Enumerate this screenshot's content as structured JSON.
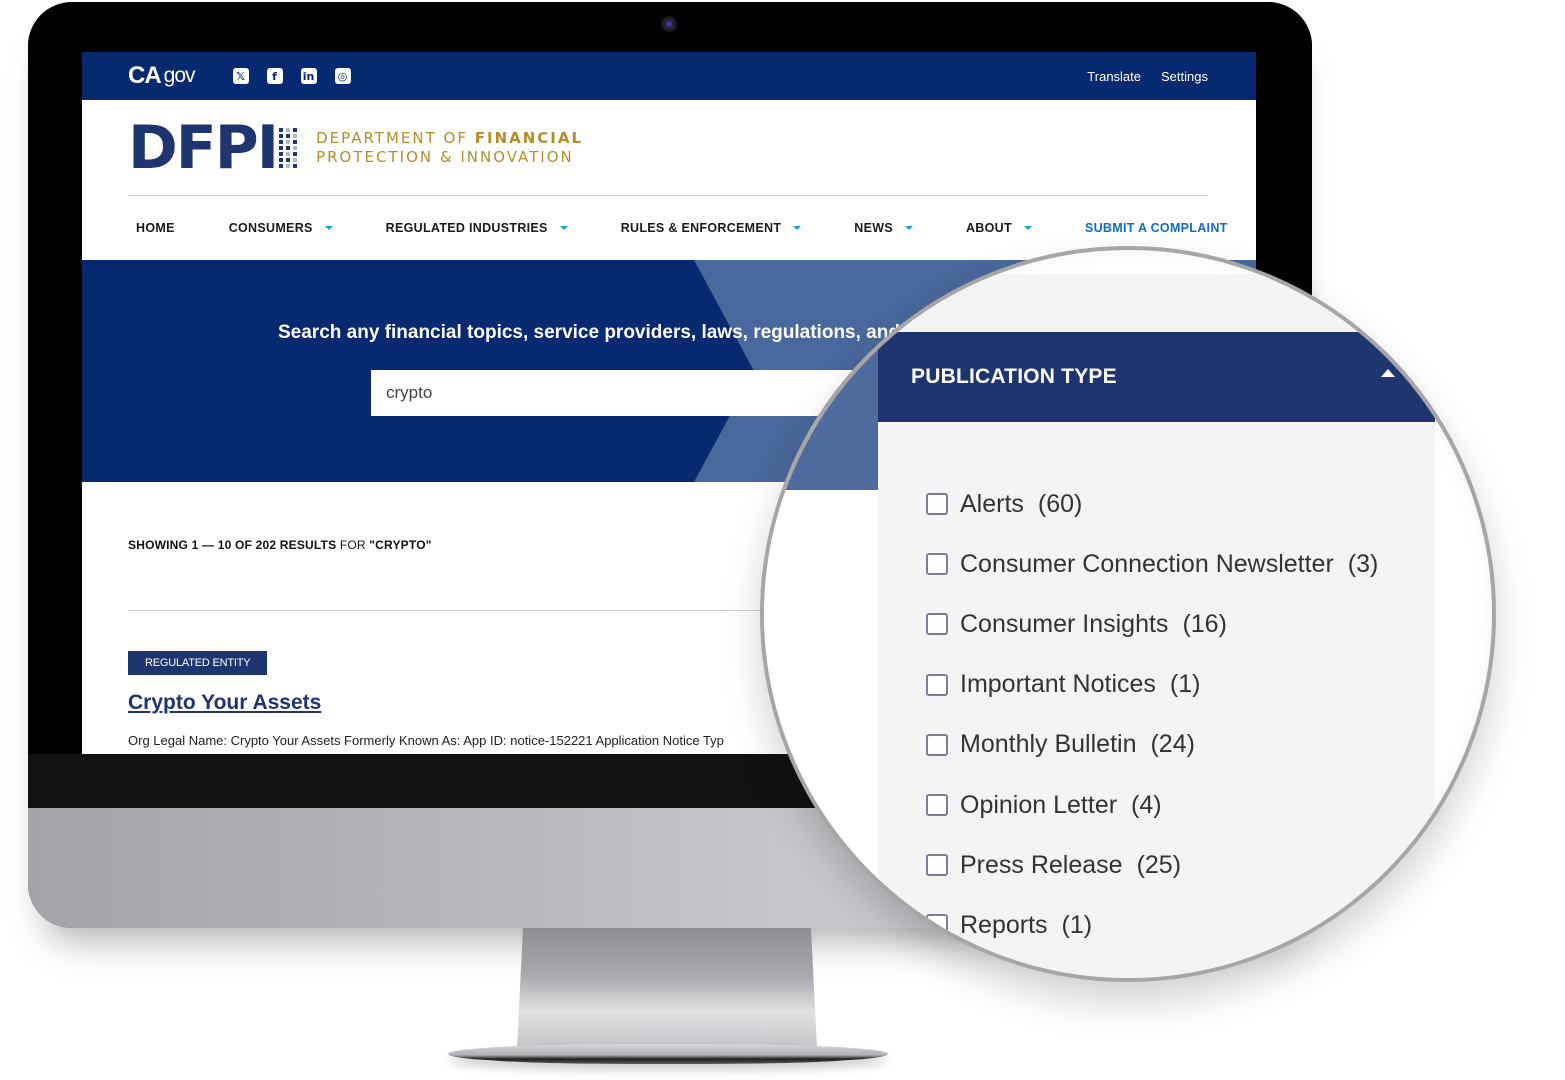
{
  "topbar": {
    "logo": "CA",
    "logo_suffix": "gov",
    "socials": [
      {
        "name": "x-icon",
        "glyph": "𝕏"
      },
      {
        "name": "facebook-icon",
        "glyph": "f"
      },
      {
        "name": "linkedin-icon",
        "glyph": "in"
      },
      {
        "name": "instagram-icon",
        "glyph": "◎"
      }
    ],
    "links": [
      "Translate",
      "Settings"
    ]
  },
  "brand": {
    "letters": "DFP",
    "letter_last": "I",
    "dept_line1_light": "DEPARTMENT OF ",
    "dept_line1_bold": "FINANCIAL",
    "dept_line2": "PROTECTION & INNOVATION"
  },
  "nav": {
    "items": [
      {
        "label": "HOME",
        "dropdown": false
      },
      {
        "label": "CONSUMERS",
        "dropdown": true
      },
      {
        "label": "REGULATED INDUSTRIES",
        "dropdown": true
      },
      {
        "label": "RULES & ENFORCEMENT",
        "dropdown": true
      },
      {
        "label": "NEWS",
        "dropdown": true
      },
      {
        "label": "ABOUT",
        "dropdown": true
      },
      {
        "label": "SUBMIT A COMPLAINT",
        "dropdown": false
      }
    ]
  },
  "hero": {
    "title": "Search any financial topics, service providers, laws, regulations, and",
    "search_value": "crypto"
  },
  "results": {
    "count_bold": "SHOWING 1 — 10 OF 202 RESULTS",
    "count_light": " FOR ",
    "count_query": "\"CRYPTO\"",
    "items": [
      {
        "tag": "REGULATED ENTITY",
        "title": "Crypto Your Assets",
        "description": "Org Legal Name: Crypto Your Assets Formerly Known As: App ID: notice-152221 Application Notice Typ"
      }
    ]
  },
  "filter": {
    "title": "PUBLICATION TYPE",
    "expanded": true,
    "options": [
      {
        "label": "Alerts",
        "count": "(60)",
        "checked": false
      },
      {
        "label": "Consumer Connection Newsletter",
        "count": "(3)",
        "checked": false
      },
      {
        "label": "Consumer Insights",
        "count": "(16)",
        "checked": false
      },
      {
        "label": "Important Notices",
        "count": "(1)",
        "checked": false
      },
      {
        "label": "Monthly Bulletin",
        "count": "(24)",
        "checked": false
      },
      {
        "label": "Opinion Letter",
        "count": "(4)",
        "checked": false
      },
      {
        "label": "Press Release",
        "count": "(25)",
        "checked": false
      },
      {
        "label": "Reports",
        "count": "(1)",
        "checked": false
      }
    ]
  },
  "colors": {
    "brand_navy": "#06296f",
    "panel_navy": "#1e3570",
    "gold": "#b58e2b",
    "link_blue": "#0d6fbf",
    "caret_blue": "#1aa0e0"
  }
}
